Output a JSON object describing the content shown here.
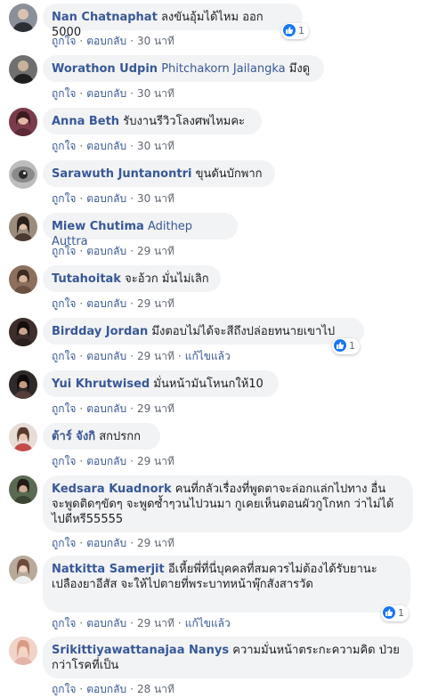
{
  "comments": [
    {
      "author": "Nan Chatnaphat",
      "tag": "",
      "text": "ลงขันอุ้มได้ไหม ออก 5000",
      "like": "ถูกใจ",
      "reply": "ตอบกลับ",
      "time": "30 นาที",
      "edited": "",
      "reactions": "1",
      "avatar_color": "#8a8f99"
    },
    {
      "author": "Worathon Udpin",
      "tag": "Phitchakorn Jailangka",
      "text": "มึงดู",
      "like": "ถูกใจ",
      "reply": "ตอบกลับ",
      "time": "30 นาที",
      "edited": "",
      "reactions": "",
      "avatar_color": "#6f6f6f"
    },
    {
      "author": "Anna Beth",
      "tag": "",
      "text": "รับงานรีวิวโลงศพไหมคะ",
      "like": "ถูกใจ",
      "reply": "ตอบกลับ",
      "time": "30 นาที",
      "edited": "",
      "reactions": "",
      "avatar_color": "#7a3b4a"
    },
    {
      "author": "Sarawuth Juntanontri",
      "tag": "",
      "text": "ขุนดันบักพาก",
      "like": "ถูกใจ",
      "reply": "ตอบกลับ",
      "time": "30 นาที",
      "edited": "",
      "reactions": "",
      "avatar_color": "#9a9a9a"
    },
    {
      "author": "Miew Chutima",
      "tag": "Adithep Auttra",
      "text": "",
      "like": "ถูกใจ",
      "reply": "ตอบกลับ",
      "time": "29 นาที",
      "edited": "",
      "reactions": "",
      "avatar_color": "#4a3a32"
    },
    {
      "author": "Tutahoitak",
      "tag": "",
      "text": "จะอ้วก มั่นไม่เลิก",
      "like": "ถูกใจ",
      "reply": "ตอบกลับ",
      "time": "29 นาที",
      "edited": "",
      "reactions": "",
      "avatar_color": "#8c6f5d"
    },
    {
      "author": "Birdday Jordan",
      "tag": "",
      "text": "มึงตอบไม่ได้จะสีถึงปล่อยทนายเขาไป",
      "like": "ถูกใจ",
      "reply": "ตอบกลับ",
      "time": "29 นาที",
      "edited": "แก้ไขแล้ว",
      "reactions": "1",
      "avatar_color": "#3c2e2a"
    },
    {
      "author": "Yui Khrutwised",
      "tag": "",
      "text": "มั่นหน้ามันโหนกให้10",
      "like": "ถูกใจ",
      "reply": "ตอบกลับ",
      "time": "29 นาที",
      "edited": "",
      "reactions": "",
      "avatar_color": "#2f2a2a"
    },
    {
      "author": "ต้าร์ จังกิ",
      "tag": "",
      "text": "สกปรกก",
      "like": "ถูกใจ",
      "reply": "ตอบกลับ",
      "time": "29 นาที",
      "edited": "",
      "reactions": "",
      "avatar_color": "#d8c7c0"
    },
    {
      "author": "Kedsara Kuadnork",
      "tag": "",
      "text": "คนที่กลัวเรื่องที่พูดตาจะล่อกแล่กไปทาง อื่น จะพูดติดๆขัดๆ จะพูดซ้ำๆวนไปวนมา กูเคยเห็นตอนผัวกูโกหก ว่าไม่ได้ไปตีหรี55555",
      "like": "ถูกใจ",
      "reply": "ตอบกลับ",
      "time": "29 นาที",
      "edited": "",
      "reactions": "",
      "avatar_color": "#5b6a52"
    },
    {
      "author": "Natkitta Samerjit",
      "tag": "",
      "text": "อีเหี้ยพึ่ที่นี่บุคคลที่สมควรไม่ต้องได้รับยานะ เปลืองยาอีสัส จะให้ไปตายที่พระบาทหน้าพุ๊กสังสารวัด",
      "like": "ถูกใจ",
      "reply": "ตอบกลับ",
      "time": "29 นาที",
      "edited": "แก้ไขแล้ว",
      "reactions": "1",
      "avatar_color": "#b9a99b"
    },
    {
      "author": "Srikittiyawattanajaa Nanys",
      "tag": "",
      "text": "ความมั่นหน้าตระกะความคิด ป่วย กว่าโรคที่เป็น",
      "like": "ถูกใจ",
      "reply": "ตอบกลับ",
      "time": "28 นาที",
      "edited": "",
      "reactions": "",
      "avatar_color": "#e6b3a8"
    }
  ],
  "colors": {
    "link": "#385898",
    "bubble": "#f2f3f5",
    "meta": "#606770",
    "like_badge": "#1877f2"
  }
}
